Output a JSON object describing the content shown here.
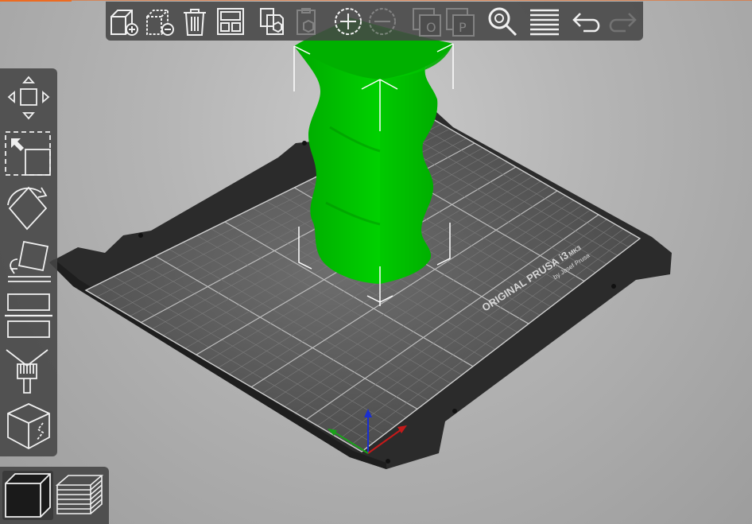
{
  "colors": {
    "accent": "#ed6b21",
    "model": "#00c400",
    "bed": "#2e2e2e",
    "toolbar_bg": "#464646"
  },
  "bed": {
    "brand_text": "ORIGINAL PRUSA i3",
    "model_text": "MK3",
    "byline_text": "by Josef Prusa"
  },
  "top_toolbar": {
    "buttons": [
      {
        "name": "add-icon",
        "enabled": true
      },
      {
        "name": "delete-icon",
        "enabled": true
      },
      {
        "name": "delete-all-icon",
        "enabled": true
      },
      {
        "name": "arrange-icon",
        "enabled": true
      },
      {
        "name": "copy-icon",
        "enabled": true
      },
      {
        "name": "paste-icon",
        "enabled": false
      },
      {
        "name": "add-instance-icon",
        "enabled": true
      },
      {
        "name": "remove-instance-icon",
        "enabled": false
      },
      {
        "name": "split-to-objects-icon",
        "enabled": false
      },
      {
        "name": "split-to-parts-icon",
        "enabled": false
      },
      {
        "name": "search-icon",
        "enabled": true
      },
      {
        "name": "layers-editing-icon",
        "enabled": true
      },
      {
        "name": "undo-icon",
        "enabled": true
      },
      {
        "name": "redo-icon",
        "enabled": false
      }
    ]
  },
  "gizmo_toolbar": {
    "tools": [
      "move-icon",
      "scale-icon",
      "rotate-icon",
      "place-on-face-icon",
      "cut-icon",
      "paint-supports-icon",
      "seam-painting-icon"
    ]
  },
  "view_toggle": {
    "views": [
      "3d-view-icon",
      "preview-layers-icon"
    ],
    "active": "3d-view-icon"
  }
}
